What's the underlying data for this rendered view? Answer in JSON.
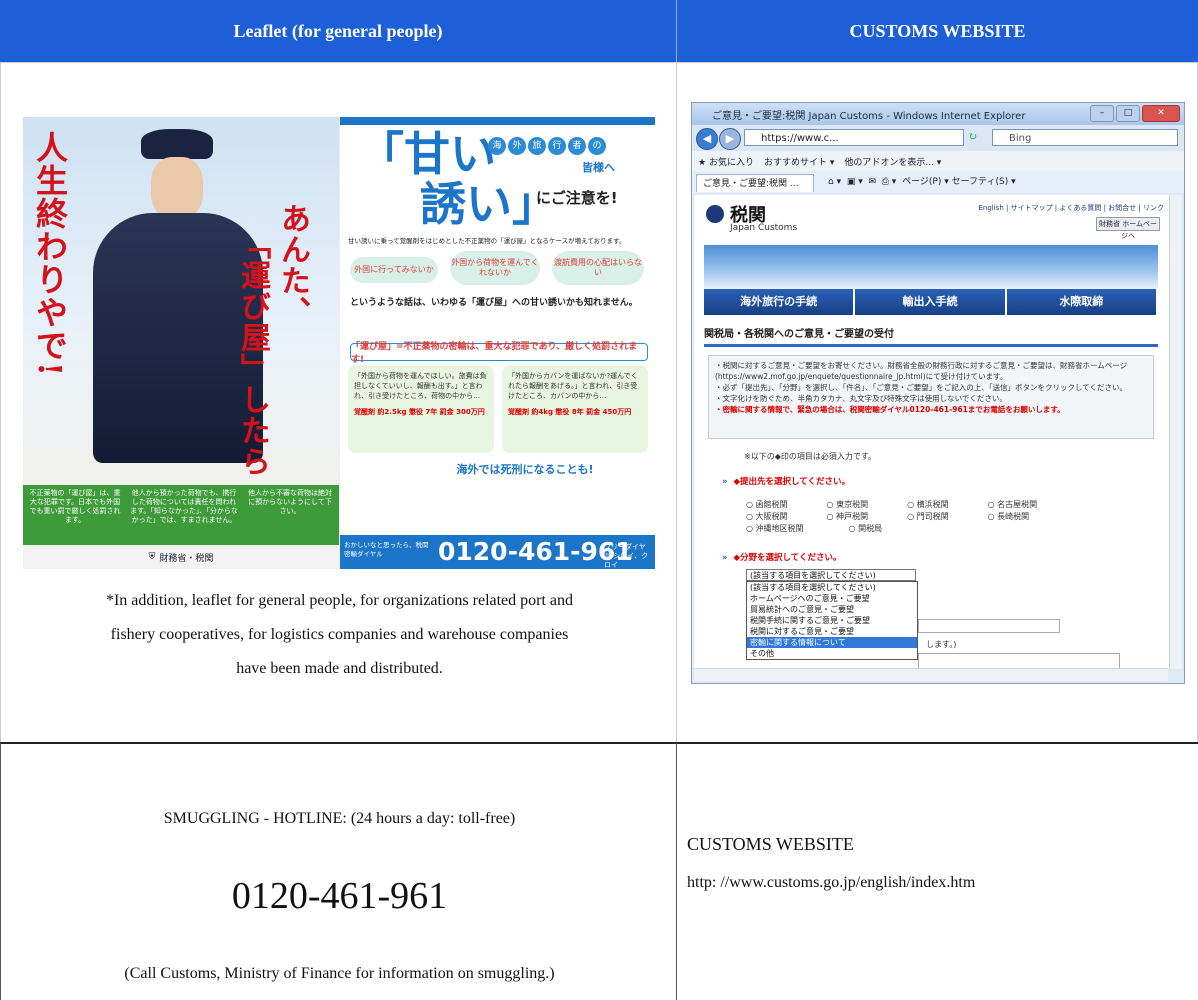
{
  "headers": {
    "left": "Leaflet (for general people)",
    "right": "CUSTOMS WEBSITE"
  },
  "leaflet": {
    "vertical_text_1": "あんた、",
    "vertical_text_2": "「運び屋」したら",
    "vertical_text_3": "人生終わりやで!",
    "green_boxes": [
      "不正薬物の「運び屋」は、重大な犯罪です。日本でも外国でも重い罰で厳しく処罰されます。",
      "他人から預かった荷物でも、携行した荷物については責任を問われます。「知らなかった」、「分からなかった」では、すまされません。",
      "他人から不審な荷物は絶対に預からないようにして下さい。"
    ],
    "footer_org": "財務省・税関",
    "headline_1": "「甘い",
    "headline_2": "誘い」",
    "headline_suffix": "にご注意を!",
    "circles": [
      "海",
      "外",
      "旅",
      "行",
      "者",
      "の"
    ],
    "circles_2": "皆様へ",
    "intro": "甘い誘いに乗って覚醒剤をはじめとした不正薬物の「運び屋」となるケースが増えております。",
    "bubbles": [
      "外国に行ってみないか",
      "外国から荷物を運んでくれないか",
      "渡航費用の心配はいらない"
    ],
    "subline": "というような話は、いわゆる「運び屋」への甘い誘いかも知れません。",
    "pill": "「運び屋」=不正薬物の密輸は、重大な犯罪であり、厳しく処罰されます!",
    "case1": "「外国から荷物を運んでほしい。旅費は負担しなくていいし、報酬も出す。」と言われ、引き受けたところ、荷物の中から…",
    "case1_penalty": "覚醒剤 約2.5kg 懲役 7年 罰金 300万円",
    "case2": "「外国からカバンを運ばないか?運んでくれたら報酬をあげる。」と言われ、引き受けたところ、カバンの中から…",
    "case2_penalty": "覚醒剤 約4kg 懲役 8年 罰金 450万円",
    "death_penalty": "海外では死刑になることも!",
    "band_label": "おかしいなと思ったら、税関密輸ダイヤル",
    "band_number": "0120-461-961",
    "band_tail": "フリーダイヤル シロイ、クロイ"
  },
  "note": {
    "line1": "*In addition, leaflet for general people, for organizations related port and",
    "line2": "fishery cooperatives, for logistics companies and warehouse companies",
    "line3": "have been made and distributed."
  },
  "browser": {
    "title": "ご意見・ご要望:税関 Japan Customs - Windows Internet Explorer",
    "url": "https://www.c...",
    "search_placeholder": "Bing",
    "favorites": "お気に入り",
    "fav_items": [
      "おすすめサイト ▾",
      "他のアドオンを表示... ▾"
    ],
    "tab": "ご意見・ご要望:税関 ...",
    "toolbar": "ページ(P) ▾  セーフティ(S) ▾",
    "logo_jp": "税関",
    "logo_en": "Japan Customs",
    "toplinks": "English | サイトマップ | よくある質問 | お問合せ | リンク",
    "mof_button": "財務省 ホームページへ",
    "nav": [
      "海外旅行の手続",
      "輸出入手続",
      "水際取締"
    ],
    "section_title": "関税局・各税関へのご意見・ご要望の受付",
    "notice_1": "・税関に対するご意見・ご要望をお寄せください。財務省全般の財務行政に対するご意見・ご要望は、財務省ホームページ(https://www2.mof.go.jp/enquete/questionnaire_jp.html)にて受け付けています。",
    "notice_2": "・必ず「提出先」、「分野」を選択し、「件名」、「ご意見・ご要望」をご記入の上、「送信」ボタンをクリックしてください。",
    "notice_3": "・文字化けを防ぐため、半角カタカナ、丸文字及び特殊文字は使用しないでください。",
    "notice_red": "・密輸に関する情報で、緊急の場合は、税関密輸ダイヤル0120-461-961までお電話をお願いします。",
    "required_note": "※以下の◆印の項目は必須入力です。",
    "q1": "◆提出先を選択してください。",
    "radios": [
      "函館税関",
      "東京税関",
      "横浜税関",
      "名古屋税関",
      "大阪税関",
      "神戸税関",
      "門司税関",
      "長崎税関",
      "沖縄地区税関",
      "関税局"
    ],
    "q2": "◆分野を選択してください。",
    "select_value": "(該当する項目を選択してください)",
    "options": [
      "(該当する項目を選択してください)",
      "ホームページへのご意見・ご要望",
      "貿易統計へのご意見・ご要望",
      "税関手続に関するご意見・ご要望",
      "税関に対するご意見・ご要望",
      "密輸に関する情報について",
      "その他"
    ],
    "partial_text": "します。)"
  },
  "hotline": {
    "label": "SMUGGLING - HOTLINE: (24 hours a day: toll-free)",
    "number": "0120-461-961",
    "note": "(Call Customs, Ministry of Finance for information on smuggling.)"
  },
  "website": {
    "title": "CUSTOMS WEBSITE",
    "url": "http: //www.customs.go.jp/english/index.htm"
  },
  "colors": {
    "header_blue": "#1c5fd6",
    "leaflet_red": "#d4121a",
    "leaflet_blue": "#1b75c8",
    "leaflet_green": "#3e9b3a"
  }
}
